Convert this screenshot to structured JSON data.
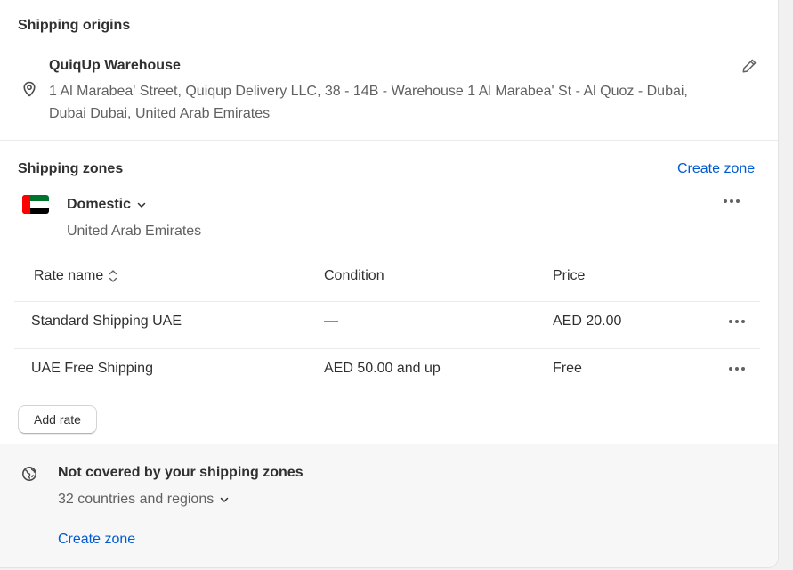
{
  "origins": {
    "title": "Shipping origins",
    "name": "QuiqUp Warehouse",
    "address": "1 Al Marabea' Street, Quiqup Delivery LLC, 38 - 14B - Warehouse 1 Al Marabea' St - Al Quoz - Dubai, Dubai Dubai, United Arab Emirates",
    "edit_icon": "pencil-icon",
    "location_icon": "location-pin-icon"
  },
  "zones": {
    "title": "Shipping zones",
    "create_link": "Create zone",
    "zone": {
      "name": "Domestic",
      "countries": "United Arab Emirates",
      "flag_icon": "uae-flag-icon"
    },
    "columns": [
      "Rate name",
      "Condition",
      "Price"
    ],
    "rates": [
      {
        "name": "Standard Shipping UAE",
        "condition": "—",
        "price": "AED 20.00"
      },
      {
        "name": "UAE Free Shipping",
        "condition": "AED 50.00 and up",
        "price": "Free"
      }
    ],
    "add_rate_label": "Add rate"
  },
  "not_covered": {
    "title": "Not covered by your shipping zones",
    "summary": "32 countries and regions",
    "create_link": "Create zone",
    "icon": "globe-off-icon"
  },
  "colors": {
    "link": "#005bd3",
    "text": "#303030",
    "subdued": "#616161"
  }
}
